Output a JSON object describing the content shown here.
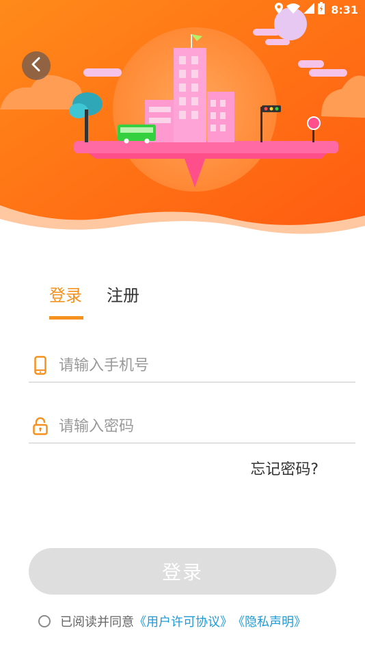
{
  "status": {
    "time": "8:31",
    "icons": [
      "location-icon",
      "wifi-icon",
      "signal-icon",
      "battery-icon"
    ]
  },
  "tabs": [
    {
      "label": "登录",
      "active": true
    },
    {
      "label": "注册",
      "active": false
    }
  ],
  "fields": {
    "phone_placeholder": "请输入手机号",
    "password_placeholder": "请输入密码"
  },
  "forgot_label": "忘记密码?",
  "login_button_label": "登录",
  "agreement": {
    "prefix": "已阅读并同意",
    "user_license": "《用户许可协议》",
    "privacy": "《隐私声明》",
    "checked": false
  },
  "colors": {
    "accent": "#f5911e",
    "link": "#1e9bd7",
    "button_disabled": "#dedede",
    "hero_orange": "#ff6a00"
  }
}
